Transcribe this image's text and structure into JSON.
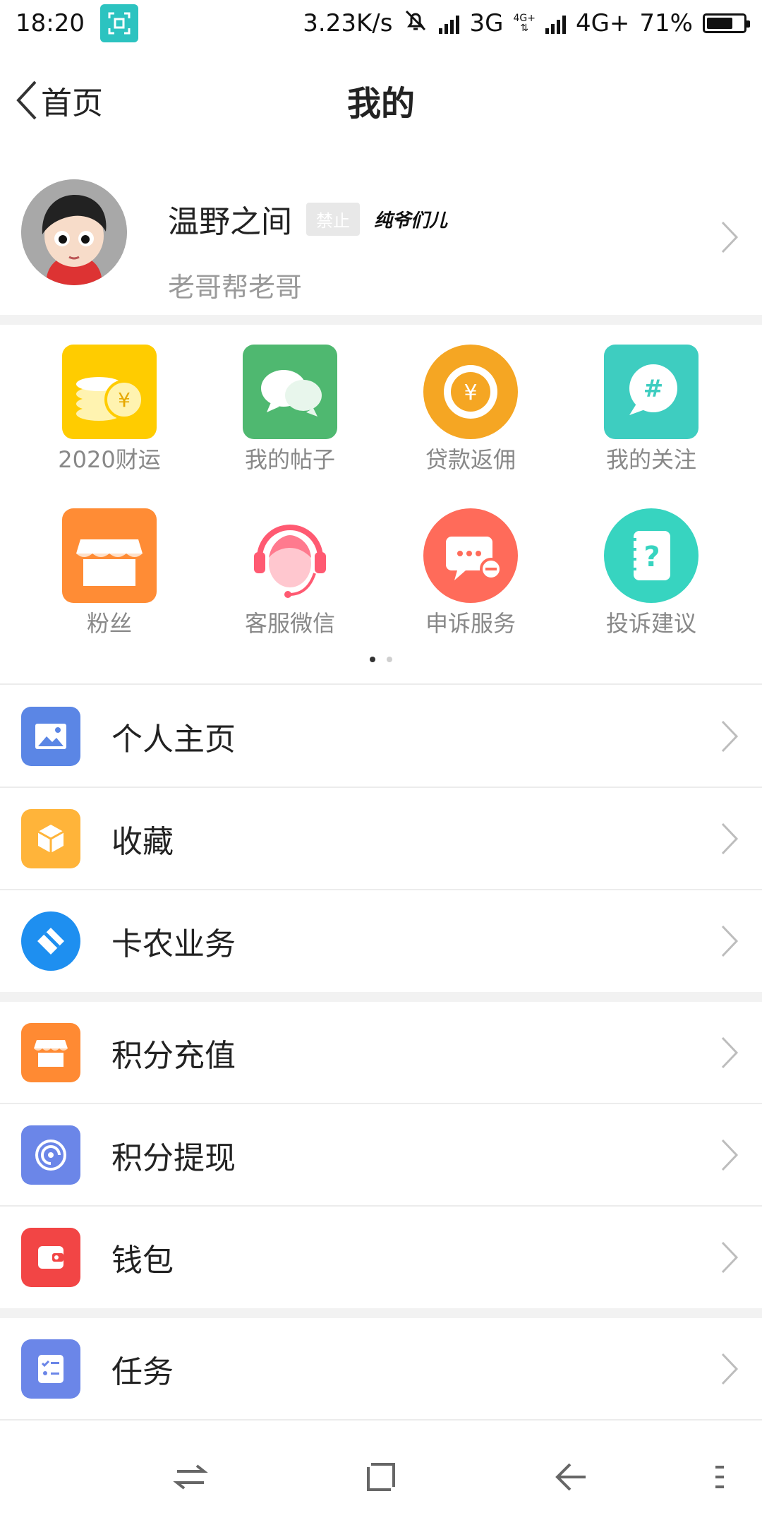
{
  "status_bar": {
    "time": "18:20",
    "net_speed": "3.23K/s",
    "net1": "3G",
    "net2_small": "4G+",
    "net2": "4G+",
    "battery": "71%",
    "battery_level": 0.71
  },
  "header": {
    "back_label": "首页",
    "title": "我的"
  },
  "profile": {
    "username": "温野之间",
    "badge": "禁止",
    "signature": "纯爷们儿",
    "subtitle": "老哥帮老哥"
  },
  "grid": {
    "items": [
      {
        "label": "2020财运",
        "icon": "coins-yen-icon",
        "color": "#ffcc00"
      },
      {
        "label": "我的帖子",
        "icon": "chat-bubbles-icon",
        "color": "#4fb870"
      },
      {
        "label": "贷款返佣",
        "icon": "coin-yen-icon",
        "color": "#f5a623"
      },
      {
        "label": "我的关注",
        "icon": "hashtag-bubble-icon",
        "color": "#3ecdc0"
      },
      {
        "label": "粉丝",
        "icon": "shop-icon",
        "color": "#ff8c35"
      },
      {
        "label": "客服微信",
        "icon": "headset-agent-icon",
        "color": "#ff7285"
      },
      {
        "label": "申诉服务",
        "icon": "message-minus-icon",
        "color": "#ff6b5a"
      },
      {
        "label": "投诉建议",
        "icon": "question-notebook-icon",
        "color": "#37d4c0"
      }
    ],
    "page_count": 2,
    "current_page": 1
  },
  "menu_group1": [
    {
      "label": "个人主页",
      "icon": "image-icon",
      "color": "#5b86e5"
    },
    {
      "label": "收藏",
      "icon": "box-icon",
      "color": "#ffb43a"
    },
    {
      "label": "卡农业务",
      "icon": "card-diamond-icon",
      "color": "#1e8ff0"
    }
  ],
  "menu_group2": [
    {
      "label": "积分充值",
      "icon": "store-icon",
      "color": "#ff8a33"
    },
    {
      "label": "积分提现",
      "icon": "spiral-icon",
      "color": "#6b86e8"
    },
    {
      "label": "钱包",
      "icon": "wallet-icon",
      "color": "#f24545"
    }
  ],
  "menu_group3": [
    {
      "label": "任务",
      "icon": "checklist-icon",
      "color": "#6b86e8"
    }
  ]
}
